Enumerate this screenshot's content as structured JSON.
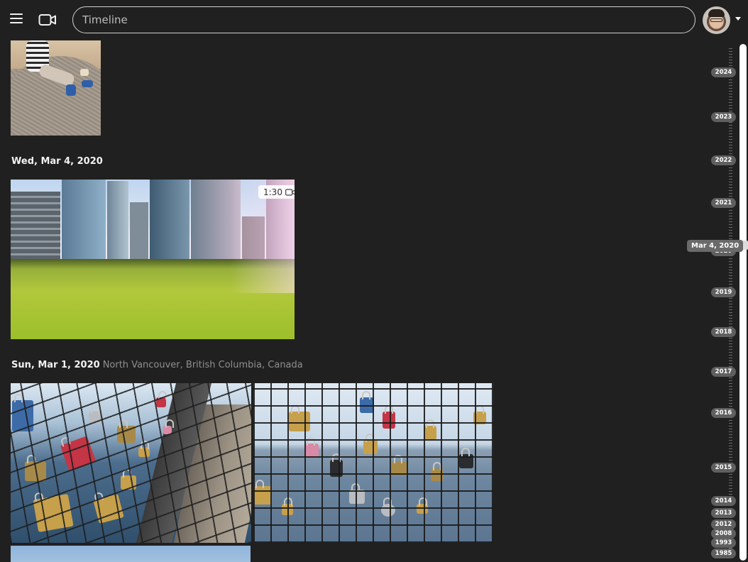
{
  "header": {
    "search_placeholder": "Timeline",
    "menu_icon": "hamburger-menu-icon",
    "video_icon": "video-camera-icon",
    "avatar_icon": "user-avatar"
  },
  "timeline": {
    "groups": [
      {
        "date": "Wed, Mar 4, 2020",
        "location": ""
      },
      {
        "date": "Sun, Mar 1, 2020",
        "location": "North Vancouver, British Columbia, Canada"
      }
    ],
    "video_duration": "1:30"
  },
  "scrubber": {
    "hover_label": "Mar 4, 2020",
    "years": [
      "2024",
      "2023",
      "2022",
      "2021",
      "2020",
      "2019",
      "2018",
      "2017",
      "2016",
      "2015",
      "2014",
      "2013",
      "2012",
      "2008",
      "1993",
      "1985"
    ]
  },
  "colors": {
    "background": "#202020",
    "year_pill": "#5f5f5f",
    "text": "#e6e6e6",
    "location_text": "#8f8f8f"
  }
}
